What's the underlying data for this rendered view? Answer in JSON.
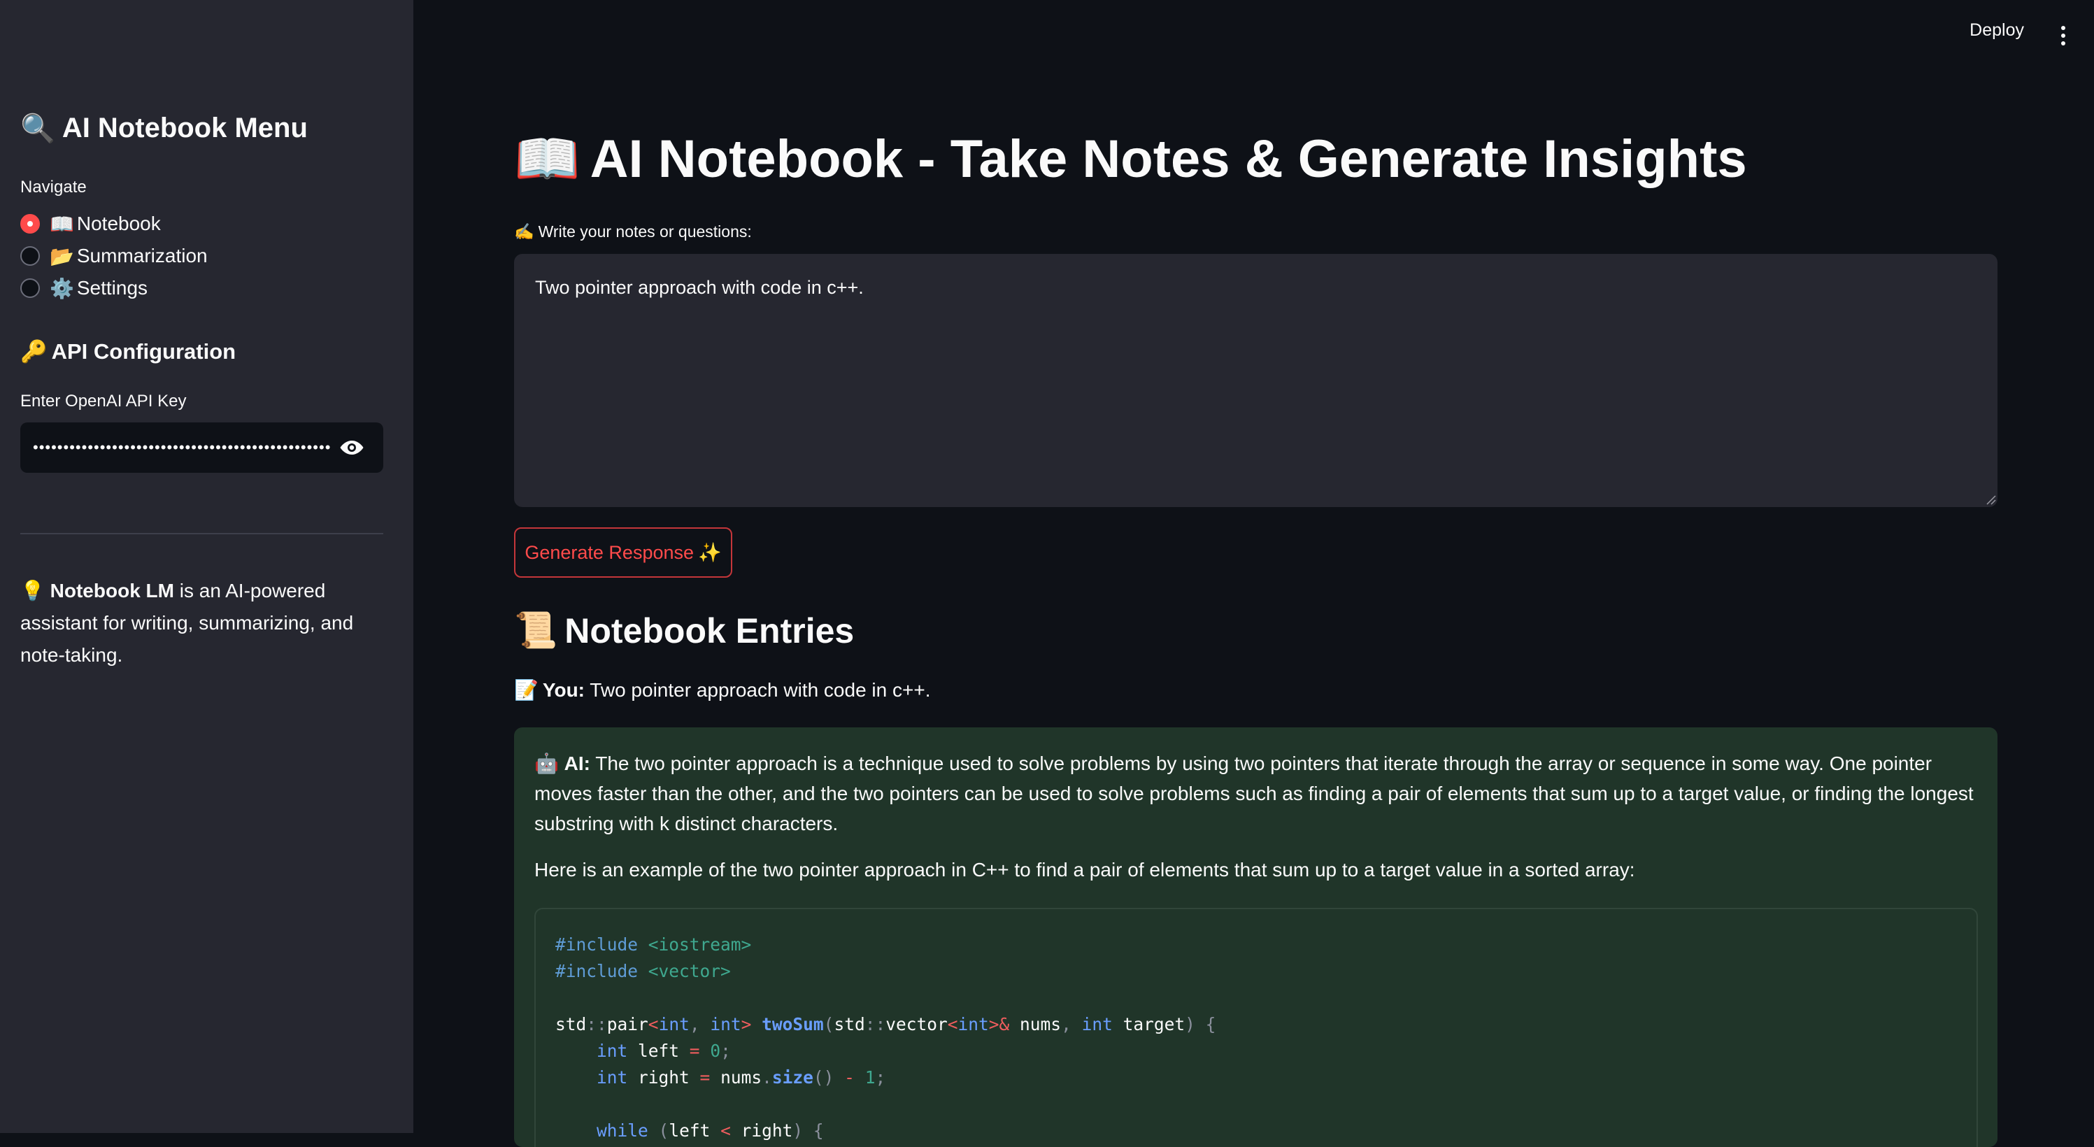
{
  "header": {
    "deploy_label": "Deploy",
    "menu_icon": "vertical-dots-icon"
  },
  "sidebar": {
    "title_icon": "🔍",
    "title": "AI Notebook Menu",
    "navigate_label": "Navigate",
    "nav_options": [
      {
        "icon": "📖",
        "label": "Notebook",
        "selected": true
      },
      {
        "icon": "📂",
        "label": "Summarization",
        "selected": false
      },
      {
        "icon": "⚙️",
        "label": "Settings",
        "selected": false
      }
    ],
    "api_section_icon": "🔑",
    "api_section_title": "API Configuration",
    "api_key_label": "Enter OpenAI API Key",
    "api_key_value": "••••••••••••••••••••••••••••••••••••••••••••••••••••",
    "info_icon": "💡",
    "info_bold": "Notebook LM",
    "info_text": " is an AI-powered assistant for writing, summarizing, and note-taking."
  },
  "main": {
    "title_icon": "📖",
    "title": "AI Notebook - Take Notes & Generate Insights",
    "notes_label_icon": "✍️",
    "notes_label": "Write your notes or questions:",
    "notes_value": "Two pointer approach with code in c++.",
    "generate_label": "Generate Response",
    "generate_icon": "✨",
    "entries_icon": "📜",
    "entries_title": "Notebook Entries",
    "you_icon": "📝",
    "you_label": "You:",
    "you_text": " Two pointer approach with code in c++.",
    "ai_icon": "🤖",
    "ai_label": "AI:",
    "ai_paragraph": " The two pointer approach is a technique used to solve problems by using two pointers that iterate through the array or sequence in some way. One pointer moves faster than the other, and the two pointers can be used to solve problems such as finding a pair of elements that sum up to a target value, or finding the longest substring with k distinct characters.",
    "ai_paragraph2": "Here is an example of the two pointer approach in C++ to find a pair of elements that sum up to a target value in a sorted array:",
    "code_lines": [
      "#include <iostream>",
      "#include <vector>",
      "",
      "std::pair<int, int> twoSum(std::vector<int>& nums, int target) {",
      "    int left = 0;",
      "    int right = nums.size() - 1;",
      "",
      "    while (left < right) {"
    ]
  },
  "colors": {
    "accent": "#ff4b4b",
    "sidebar_bg": "#262730",
    "app_bg": "#0e1117",
    "ai_box_bg": "#203529"
  }
}
